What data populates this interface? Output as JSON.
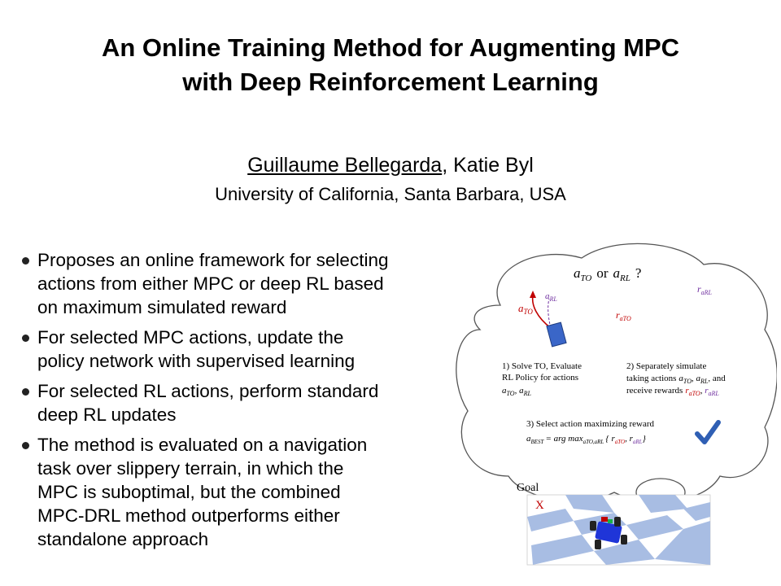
{
  "title": {
    "line1": "An Online Training Method for Augmenting MPC",
    "line2": "with Deep Reinforcement Learning"
  },
  "authors": {
    "primary": "Guillaume Bellegarda",
    "separator": ",",
    "secondary": "Katie Byl"
  },
  "affiliation": "University of California, Santa Barbara, USA",
  "bullets": [
    {
      "lines": [
        "Proposes an online framework for selecting",
        "actions from either MPC or deep RL based",
        "on maximum simulated reward"
      ]
    },
    {
      "lines": [
        "For selected MPC actions, update the",
        "policy network with supervised learning"
      ]
    },
    {
      "lines": [
        "For selected RL actions, perform standard",
        "deep RL updates"
      ]
    },
    {
      "lines": [
        "The method is evaluated on a navigation",
        "task over slippery terrain, in which the",
        "MPC is suboptimal, but the combined",
        "MPC-DRL method outperforms either",
        "standalone approach"
      ]
    }
  ],
  "diagram": {
    "question": {
      "a": "a",
      "sub_to": "TO",
      "or": "or",
      "sub_rl": "RL",
      "qmark": "?"
    },
    "step1": {
      "line1": "1) Solve TO, Evaluate",
      "line2": "RL Policy for actions",
      "math": "a",
      "sub_to": "TO",
      "comma": ", a",
      "sub_rl": "RL"
    },
    "step2": {
      "line1": "2) Separately simulate",
      "line2_pre": "taking actions",
      "line2_post": ", and",
      "line3_pre": "receive rewards"
    },
    "step3": {
      "line1": "3) Select action maximizing reward",
      "formula": "a",
      "sub_best": "BEST",
      "eq": "= arg max",
      "sub_arg": "aTO,aRL",
      "set": "{ r",
      "sub_rto": "aTO",
      "comma": ", r",
      "sub_rrl": "aRL",
      "close": "}"
    },
    "labels": {
      "a_rl": "a",
      "a_rl_sub": "RL",
      "a_to": "a",
      "a_to_sub": "TO",
      "r_to": "r",
      "r_to_sub": "aTO",
      "r_rl": "r",
      "r_rl_sub": "aRL"
    },
    "goal_label": "Goal",
    "goal_marker": "X",
    "colors": {
      "red": "#c00000",
      "purple": "#7030a0",
      "blue": "#3a66c8",
      "check": "#2f5fb4",
      "tile_dark": "#a8bde3",
      "tile_light": "#ffffff"
    }
  }
}
